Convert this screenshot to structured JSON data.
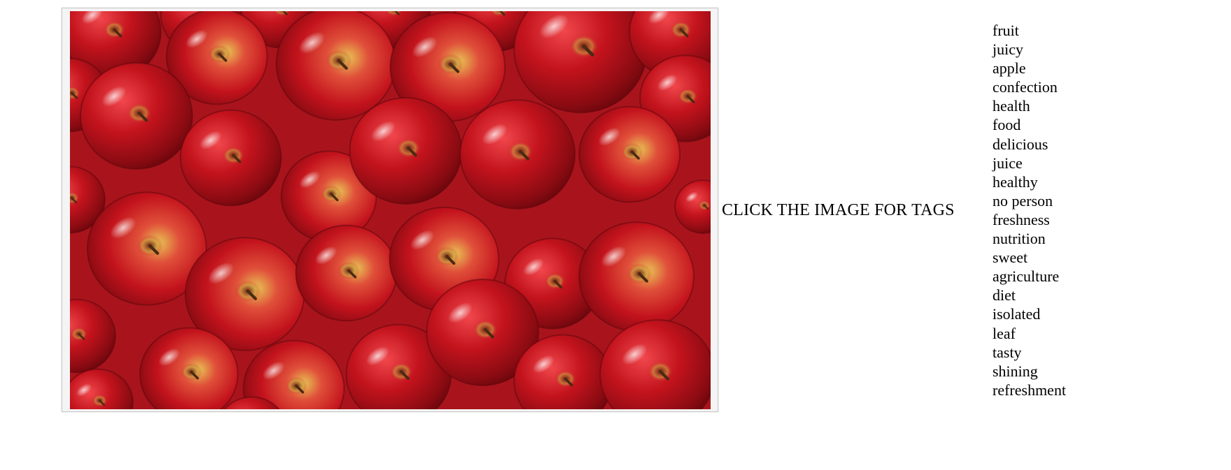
{
  "image": {
    "subject": "red-apples-photo"
  },
  "caption": "CLICK THE IMAGE FOR TAGS",
  "tags": [
    "fruit",
    "juicy",
    "apple",
    "confection",
    "health",
    "food",
    "delicious",
    "juice",
    "healthy",
    "no person",
    "freshness",
    "nutrition",
    "sweet",
    "agriculture",
    "diet",
    "isolated",
    "leaf",
    "tasty",
    "shining",
    "refreshment"
  ],
  "colors": {
    "apple_red": "#c3131d",
    "apple_dark": "#7d0a10",
    "apple_yellow": "#e8c454",
    "background_red": "#b5161f"
  }
}
